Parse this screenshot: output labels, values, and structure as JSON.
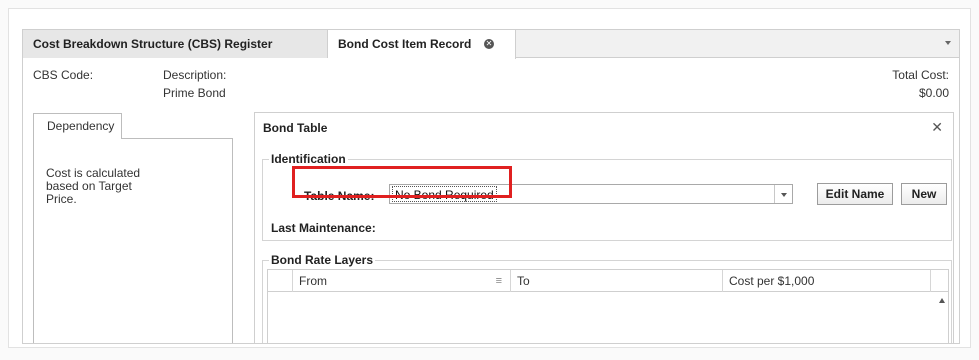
{
  "tabs": [
    {
      "label": "Cost Breakdown Structure (CBS) Register"
    },
    {
      "label": "Bond Cost Item Record"
    }
  ],
  "header": {
    "cbs_code_label": "CBS Code:",
    "description_label": "Description:",
    "description_value": "Prime Bond",
    "total_cost_label": "Total Cost:",
    "total_cost_value": "$0.00"
  },
  "left_panel": {
    "tab_label": "Dependency",
    "text": "Cost is calculated based on Target Price."
  },
  "bond_panel": {
    "title": "Bond Table",
    "identification": {
      "group_label": "Identification",
      "table_name_label": "Table Name:",
      "table_name_value": "No Bond Required",
      "edit_name_button": "Edit Name",
      "new_button": "New",
      "last_maintenance_label": "Last Maintenance:"
    },
    "layers": {
      "group_label": "Bond Rate Layers",
      "columns": [
        "From",
        "To",
        "Cost per $1,000"
      ]
    }
  },
  "colors": {
    "highlight": "#e02020"
  }
}
